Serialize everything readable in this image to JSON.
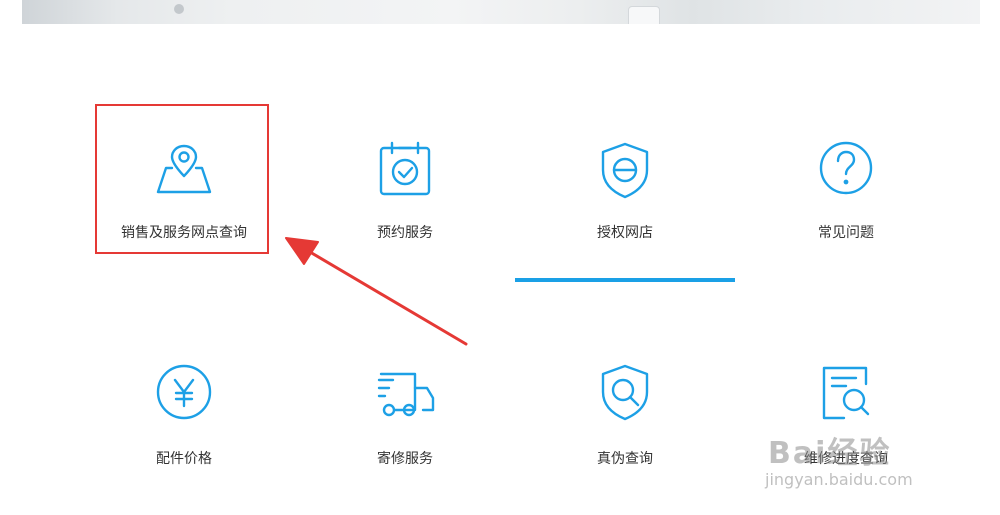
{
  "services": [
    {
      "label": "销售及服务网点查询",
      "icon": "map-location-icon"
    },
    {
      "label": "预约服务",
      "icon": "calendar-check-icon"
    },
    {
      "label": "授权网店",
      "icon": "shield-e-icon"
    },
    {
      "label": "常见问题",
      "icon": "question-circle-icon"
    },
    {
      "label": "配件价格",
      "icon": "yen-circle-icon"
    },
    {
      "label": "寄修服务",
      "icon": "truck-icon"
    },
    {
      "label": "真伪查询",
      "icon": "shield-search-icon"
    },
    {
      "label": "维修进度查询",
      "icon": "document-search-icon"
    }
  ],
  "selected_tab": "授权网店",
  "accent_color": "#1da0e6",
  "annotation_color": "#e53935",
  "watermark": {
    "logo": "Bai经验",
    "url": "jingyan.baidu.com"
  }
}
